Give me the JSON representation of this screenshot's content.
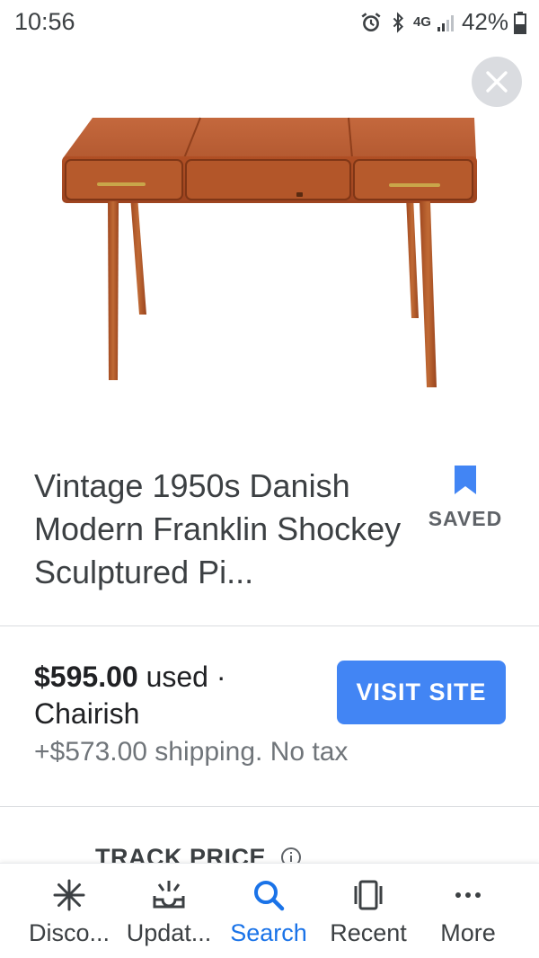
{
  "status_bar": {
    "time": "10:56",
    "network": "4G",
    "battery": "42%"
  },
  "product": {
    "title": "Vintage 1950s Danish Modern Franklin Shockey Sculptured Pi...",
    "save_label": "SAVED"
  },
  "offer": {
    "price": "$595.00",
    "condition": " used ·",
    "seller": "Chairish",
    "shipping": "+$573.00 shipping. No tax",
    "visit_label": "VISIT SITE"
  },
  "track": {
    "label": "TRACK PRICE"
  },
  "bottom_nav": {
    "items": [
      {
        "label": "Disco...",
        "icon": "asterisk-icon"
      },
      {
        "label": "Updat...",
        "icon": "updates-icon"
      },
      {
        "label": "Search",
        "icon": "search-icon"
      },
      {
        "label": "Recent",
        "icon": "recent-icon"
      },
      {
        "label": "More",
        "icon": "more-icon"
      }
    ],
    "active_color": "#1a73e8"
  },
  "colors": {
    "accent": "#4285f4",
    "bookmark": "#4285f4",
    "furniture_wood": "#b8542a"
  }
}
